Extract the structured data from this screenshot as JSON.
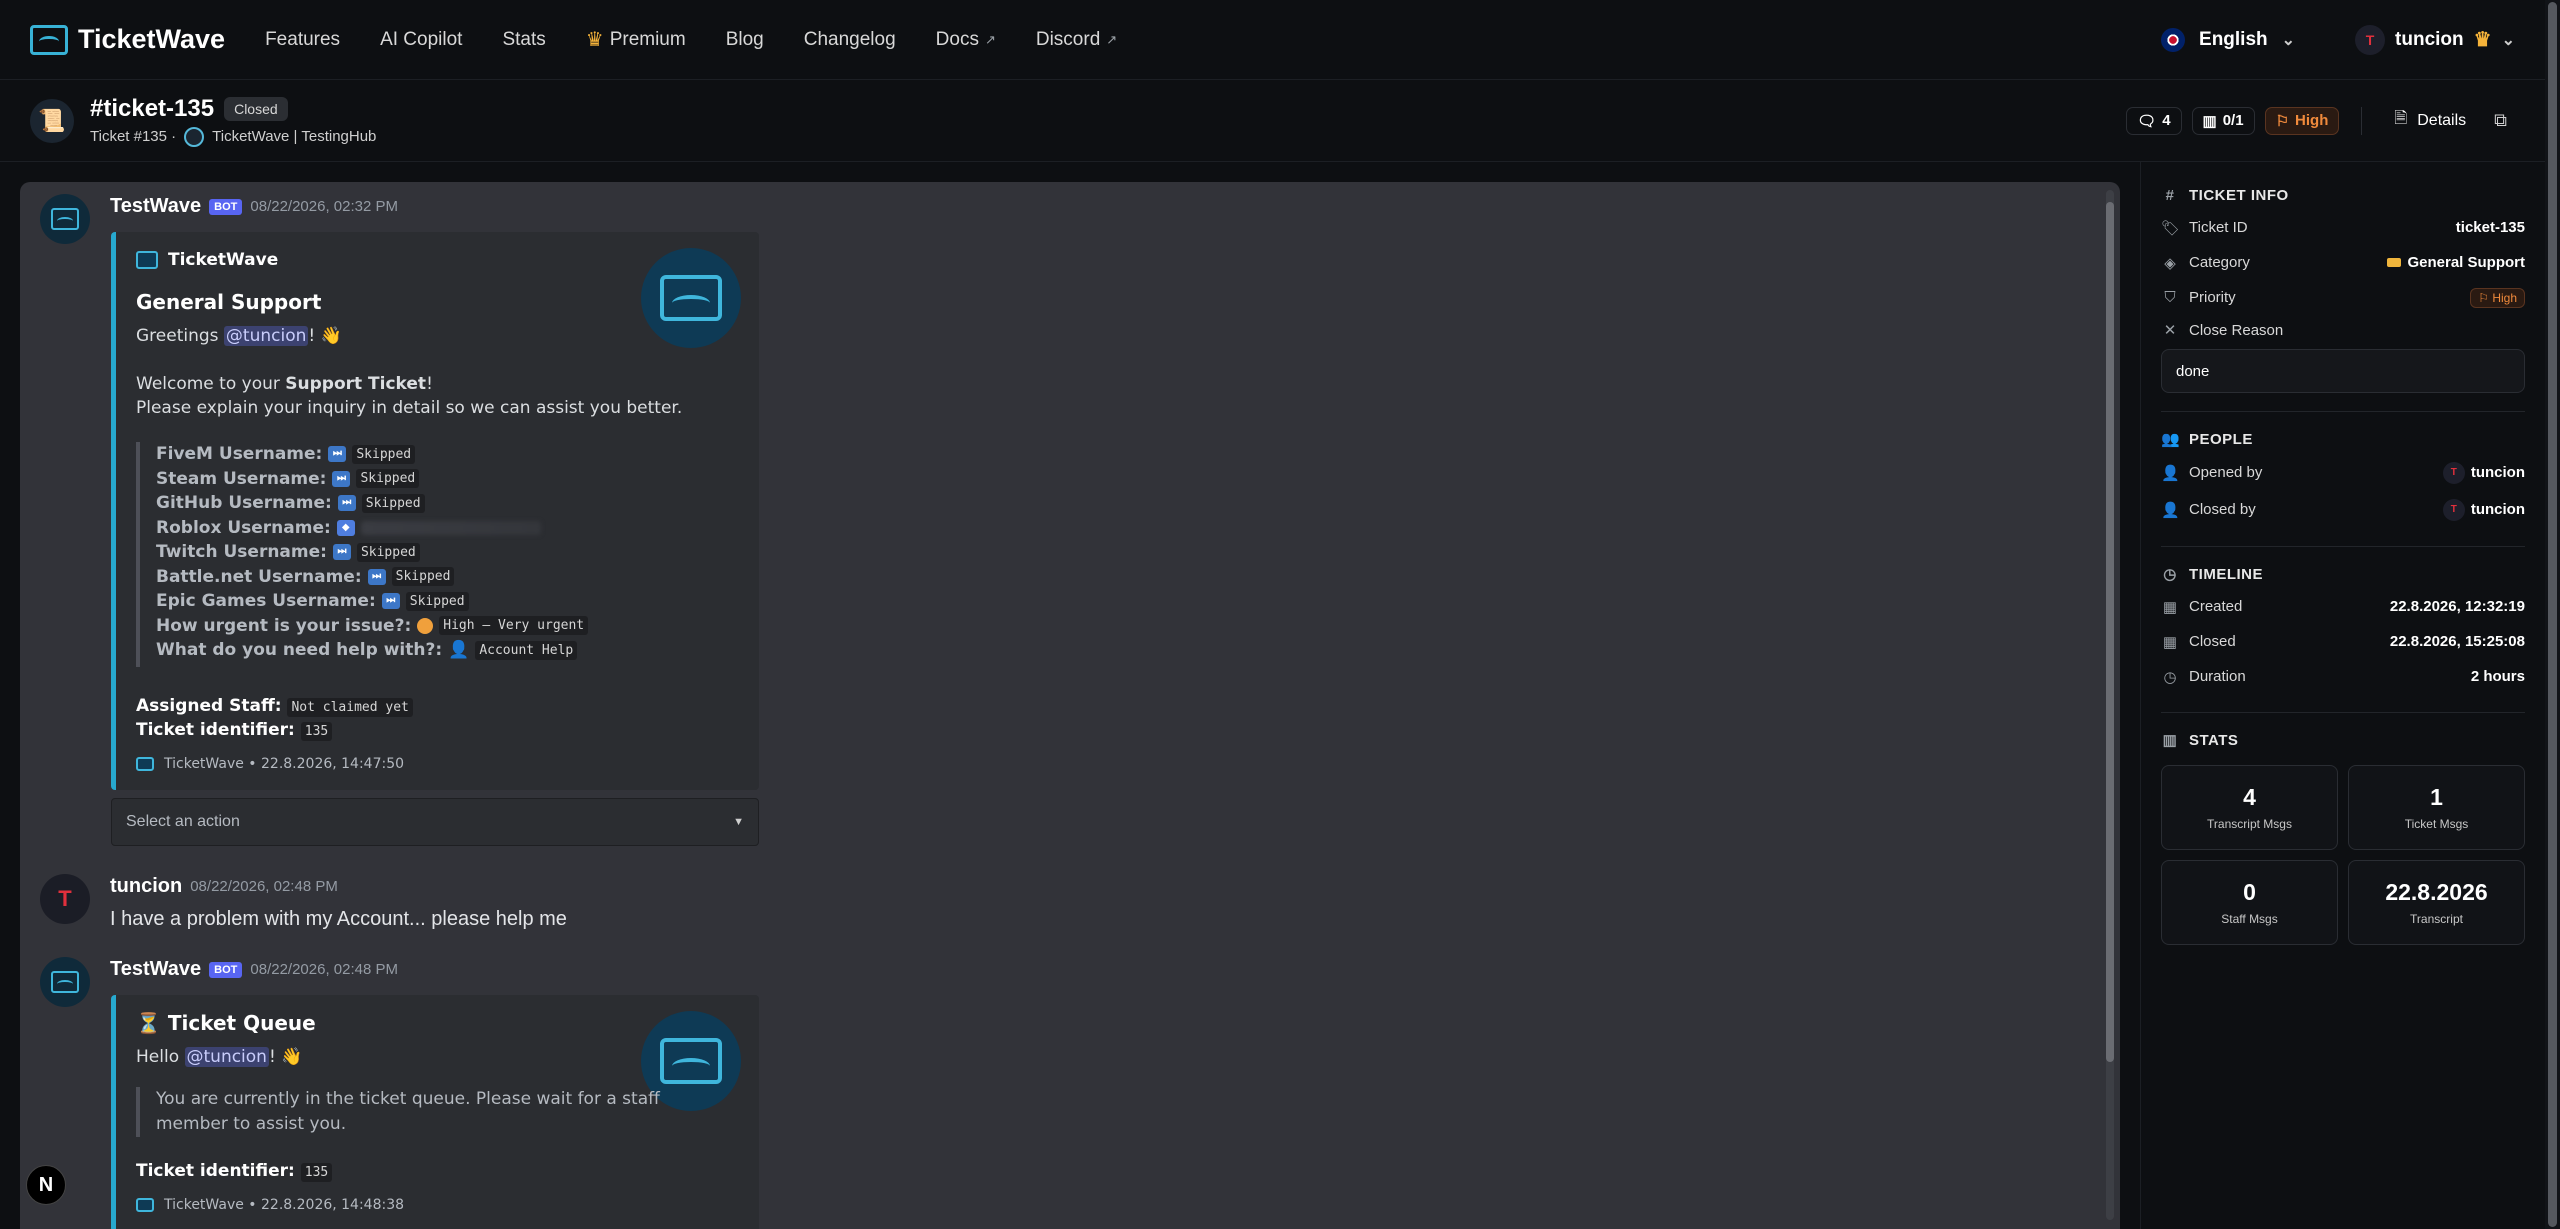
{
  "nav": {
    "brand": "TicketWave",
    "links": [
      {
        "label": "Features"
      },
      {
        "label": "AI Copilot"
      },
      {
        "label": "Stats"
      },
      {
        "label": "Premium"
      },
      {
        "label": "Blog"
      },
      {
        "label": "Changelog"
      },
      {
        "label": "Docs"
      },
      {
        "label": "Discord"
      }
    ],
    "language": "English",
    "username": "tuncion"
  },
  "ticket": {
    "title": "#ticket-135",
    "status": "Closed",
    "number_label": "Ticket #135 ·",
    "guild": "TicketWave | TestingHub",
    "messages_count": "4",
    "claimed": "0/1",
    "priority": "High",
    "details_label": "Details"
  },
  "transcript": {
    "messages": [
      {
        "author": "TestWave",
        "bot_tag": "BOT",
        "time": "08/22/2026, 02:32 PM",
        "embed": {
          "author": "TicketWave",
          "title": "General Support",
          "greeting_prefix": "Greetings ",
          "mention": "@tuncion",
          "greeting_suffix": "! 👋",
          "welcome_prefix": "Welcome to your ",
          "welcome_bold": "Support Ticket",
          "welcome_suffix": "!",
          "explain": "Please explain your inquiry in detail so we can assist you better.",
          "fields": [
            {
              "label": "FiveM Username:",
              "value": "Skipped"
            },
            {
              "label": "Steam Username:",
              "value": "Skipped"
            },
            {
              "label": "GitHub Username:",
              "value": "Skipped"
            },
            {
              "label": "Roblox Username:",
              "value": ""
            },
            {
              "label": "Twitch Username:",
              "value": "Skipped"
            },
            {
              "label": "Battle.net Username:",
              "value": "Skipped"
            },
            {
              "label": "Epic Games Username:",
              "value": "Skipped"
            },
            {
              "label": "How urgent is your issue?:",
              "value": "High — Very urgent"
            },
            {
              "label": "What do you need help with?:",
              "value": "Account Help"
            }
          ],
          "assigned_label": "Assigned Staff:",
          "assigned_value": "Not claimed yet",
          "identifier_label": "Ticket identifier:",
          "identifier_value": "135",
          "footer": "TicketWave • 22.8.2026, 14:47:50"
        },
        "select_placeholder": "Select an action"
      },
      {
        "author": "tuncion",
        "time": "08/22/2026, 02:48 PM",
        "text": "I have a problem with my Account... please help me"
      },
      {
        "author": "TestWave",
        "bot_tag": "BOT",
        "time": "08/22/2026, 02:48 PM",
        "embed": {
          "author_icon": "⏳",
          "title": "Ticket Queue",
          "greeting_prefix": "Hello ",
          "mention": "@tuncion",
          "greeting_suffix": "! 👋",
          "quote_line1": "You are currently in the ticket queue. Please wait for a staff",
          "quote_line2": "member to assist you.",
          "identifier_label": "Ticket identifier:",
          "identifier_value": "135",
          "footer": "TicketWave • 22.8.2026, 14:48:38"
        }
      }
    ]
  },
  "sidebar": {
    "info_title": "TICKET INFO",
    "ticket_id_label": "Ticket ID",
    "ticket_id": "ticket-135",
    "category_label": "Category",
    "category": "General Support",
    "priority_label": "Priority",
    "priority": "High",
    "close_reason_label": "Close Reason",
    "close_reason": "done",
    "people_title": "PEOPLE",
    "opened_by_label": "Opened by",
    "opened_by": "tuncion",
    "closed_by_label": "Closed by",
    "closed_by": "tuncion",
    "timeline_title": "TIMELINE",
    "created_label": "Created",
    "created": "22.8.2026, 12:32:19",
    "closed_label": "Closed",
    "closed": "22.8.2026, 15:25:08",
    "duration_label": "Duration",
    "duration": "2 hours",
    "stats_title": "STATS",
    "stats": [
      {
        "value": "4",
        "label": "Transcript Msgs"
      },
      {
        "value": "1",
        "label": "Ticket Msgs"
      },
      {
        "value": "0",
        "label": "Staff Msgs"
      },
      {
        "value": "22.8.2026",
        "label": "Transcript"
      }
    ]
  },
  "colors": {
    "accent": "#27a9cf",
    "priority_high": "#f08a3c",
    "bot_tag": "#5865f2",
    "background": "#0d0f12",
    "transcript_bg": "#323339"
  }
}
